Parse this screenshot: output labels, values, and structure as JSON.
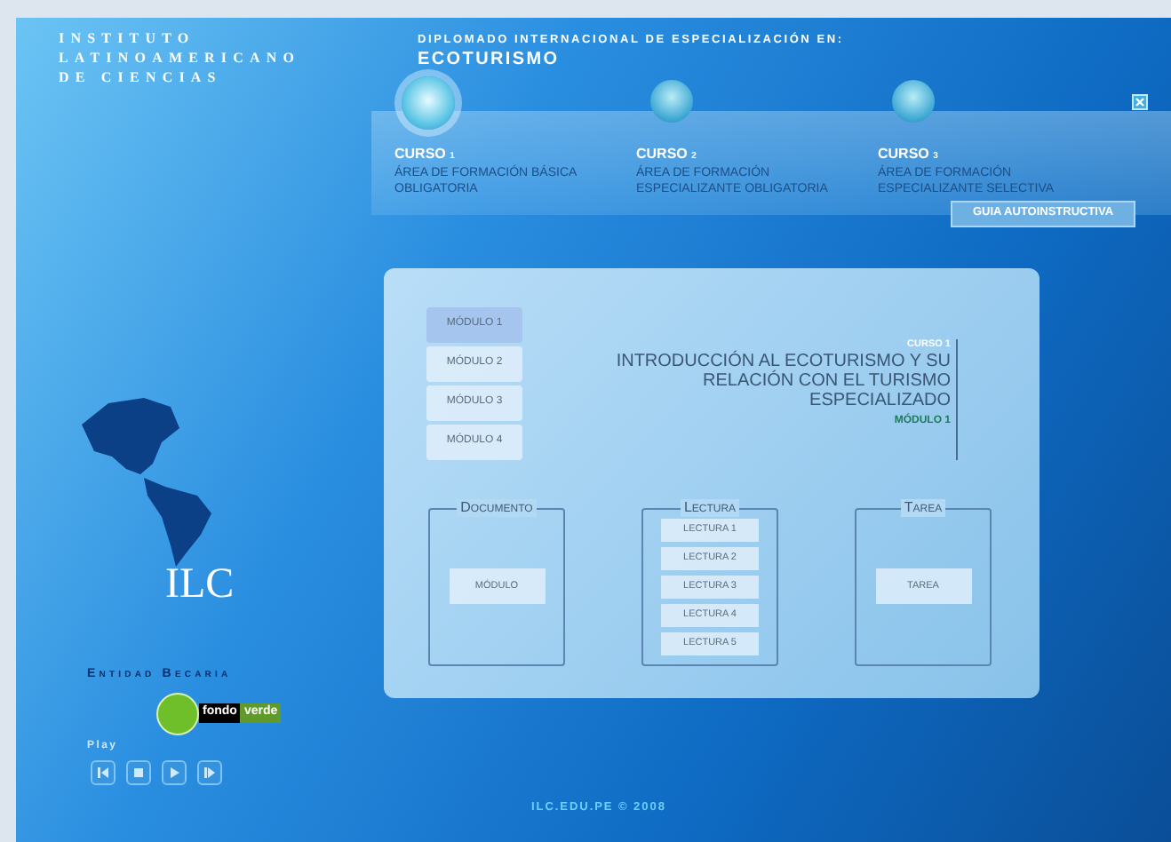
{
  "institute": {
    "lines": [
      "INSTITUTO",
      "LATINOAMERICANO",
      "DE CIENCIAS"
    ]
  },
  "header": {
    "subtitle": "DIPLOMADO INTERNACIONAL DE ESPECIALIZACIÓN EN:",
    "title": "ECOTURISMO"
  },
  "courses": [
    {
      "label": "CURSO",
      "number": "1",
      "description": "ÁREA DE FORMACIÓN BÁSICA OBLIGATORIA",
      "selected": true
    },
    {
      "label": "CURSO",
      "number": "2",
      "description": "ÁREA DE FORMACIÓN ESPECIALIZANTE OBLIGATORIA",
      "selected": false
    },
    {
      "label": "CURSO",
      "number": "3",
      "description": "ÁREA DE FORMACIÓN ESPECIALIZANTE SELECTIVA",
      "selected": false
    }
  ],
  "guide_button": "GUIA AUTOINSTRUCTIVA",
  "modules": [
    {
      "label": "MÓDULO 1",
      "selected": true
    },
    {
      "label": "MÓDULO 2",
      "selected": false
    },
    {
      "label": "MÓDULO 3",
      "selected": false
    },
    {
      "label": "MÓDULO 4",
      "selected": false
    }
  ],
  "content": {
    "course_label": "CURSO 1",
    "title": "INTRODUCCIÓN AL ECOTURISMO Y SU RELACIÓN CON EL TURISMO ESPECIALIZADO",
    "module_label": "MÓDULO 1"
  },
  "sections": [
    {
      "title": "Documento",
      "items": [
        "MÓDULO"
      ]
    },
    {
      "title": "Lectura",
      "items": [
        "LECTURA 1",
        "LECTURA 2",
        "LECTURA 3",
        "LECTURA 4",
        "LECTURA 5"
      ]
    },
    {
      "title": "Tarea",
      "items": [
        "TAREA"
      ]
    }
  ],
  "logo": "ILC",
  "sponsor": {
    "label": "Entidad Becaria",
    "logo_words": [
      "fondo",
      "verde"
    ]
  },
  "player": {
    "label": "Play"
  },
  "footer": "ILC.EDU.PE © 2008"
}
